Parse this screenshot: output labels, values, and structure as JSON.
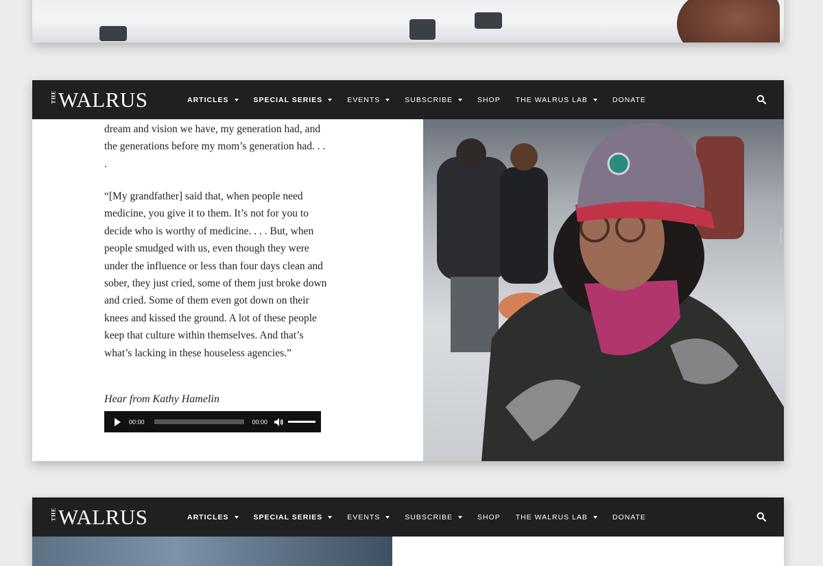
{
  "nav": {
    "logo_the": "THE",
    "logo_word": "WALRUS",
    "items": [
      {
        "label": "ARTICLES",
        "dropdown": true,
        "bold": true
      },
      {
        "label": "SPECIAL SERIES",
        "dropdown": true,
        "bold": true
      },
      {
        "label": "EVENTS",
        "dropdown": true,
        "bold": false
      },
      {
        "label": "SUBSCRIBE",
        "dropdown": true,
        "bold": false
      },
      {
        "label": "SHOP",
        "dropdown": false,
        "bold": false
      },
      {
        "label": "THE WALRUS LAB",
        "dropdown": true,
        "bold": false
      },
      {
        "label": "DONATE",
        "dropdown": false,
        "bold": false
      }
    ],
    "search_icon": "search-icon"
  },
  "article": {
    "para1": "dream and vision we have, my generation had, and the generations before my mom’s generation had. . . .",
    "para2": "“[My grandfather] said that, when people need medicine, you give it to them. It’s not for you to decide who is worthy of medicine. . . . But, when people smudged with us, even though they were under the influence or less than four days clean and sober, they just cried, some of them just broke down and cried. Some of them even got down on their knees and kissed the ground. A lot of these people keep that culture within themselves. And that’s what’s lacking in these houseless agencies.”",
    "caption": "Hear from Kathy Hamelin"
  },
  "audio": {
    "current_time": "00:00",
    "duration": "00:00",
    "progress": 0
  },
  "colors": {
    "nav_bg": "#202020",
    "page_bg": "#ebebeb"
  }
}
